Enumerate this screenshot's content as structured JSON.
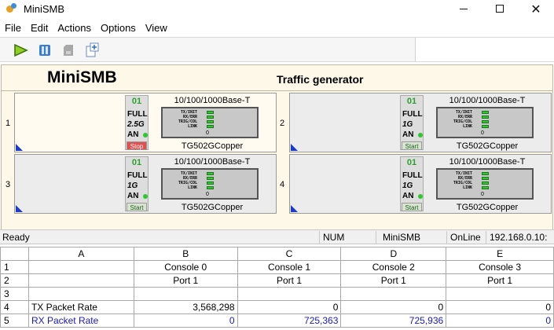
{
  "window": {
    "title": "MiniSMB"
  },
  "menu": [
    "File",
    "Edit",
    "Actions",
    "Options",
    "View"
  ],
  "toolbar": {
    "icons": [
      "play-icon",
      "pause-icon",
      "disk-icon",
      "new-document-icon"
    ]
  },
  "header": {
    "brand": "MiniSMB",
    "subtitle": "Traffic generator"
  },
  "ports": [
    {
      "index": "1",
      "num": "01",
      "duplex": "FULL",
      "speed": "2.5G",
      "an": "AN",
      "button": "Stop",
      "phy": "10/100/1000Base-T",
      "model": "TG502GCopper",
      "leds": [
        "TX/INIT",
        "RX/ERR",
        "TRIG/COL",
        "LINK"
      ],
      "count": "0"
    },
    {
      "index": "2",
      "num": "01",
      "duplex": "FULL",
      "speed": "1G",
      "an": "AN",
      "button": "Start",
      "phy": "10/100/1000Base-T",
      "model": "TG502GCopper",
      "leds": [
        "TX/INIT",
        "RX/ERR",
        "TRIG/COL",
        "LINK"
      ],
      "count": "0"
    },
    {
      "index": "3",
      "num": "01",
      "duplex": "FULL",
      "speed": "1G",
      "an": "AN",
      "button": "Start",
      "phy": "10/100/1000Base-T",
      "model": "TG502GCopper",
      "leds": [
        "TX/INIT",
        "RX/ERR",
        "TRIG/COL",
        "LINK"
      ],
      "count": "0"
    },
    {
      "index": "4",
      "num": "01",
      "duplex": "FULL",
      "speed": "1G",
      "an": "AN",
      "button": "Start",
      "phy": "10/100/1000Base-T",
      "model": "TG502GCopper",
      "leds": [
        "TX/INIT",
        "RX/ERR",
        "TRIG/COL",
        "LINK"
      ],
      "count": "0"
    }
  ],
  "status": {
    "ready": "Ready",
    "num": "NUM",
    "app": "MiniSMB",
    "online": "OnLine",
    "ip": "192.168.0.10:"
  },
  "grid": {
    "columns": [
      "",
      "A",
      "B",
      "C",
      "D",
      "E"
    ],
    "rows": [
      {
        "num": "1",
        "label": "",
        "values": [
          "Console 0",
          "Console 1",
          "Console 2",
          "Console 3"
        ]
      },
      {
        "num": "2",
        "label": "",
        "values": [
          "Port 1",
          "Port 1",
          "Port 1",
          "Port 1"
        ]
      },
      {
        "num": "3",
        "label": "",
        "values": [
          "",
          "",
          "",
          ""
        ]
      },
      {
        "num": "4",
        "label": "TX Packet Rate",
        "values": [
          "3,568,298",
          "0",
          "0",
          "0"
        ]
      },
      {
        "num": "5",
        "label": "RX Packet Rate",
        "values": [
          "0",
          "725,363",
          "725,936",
          "0"
        ]
      }
    ]
  }
}
